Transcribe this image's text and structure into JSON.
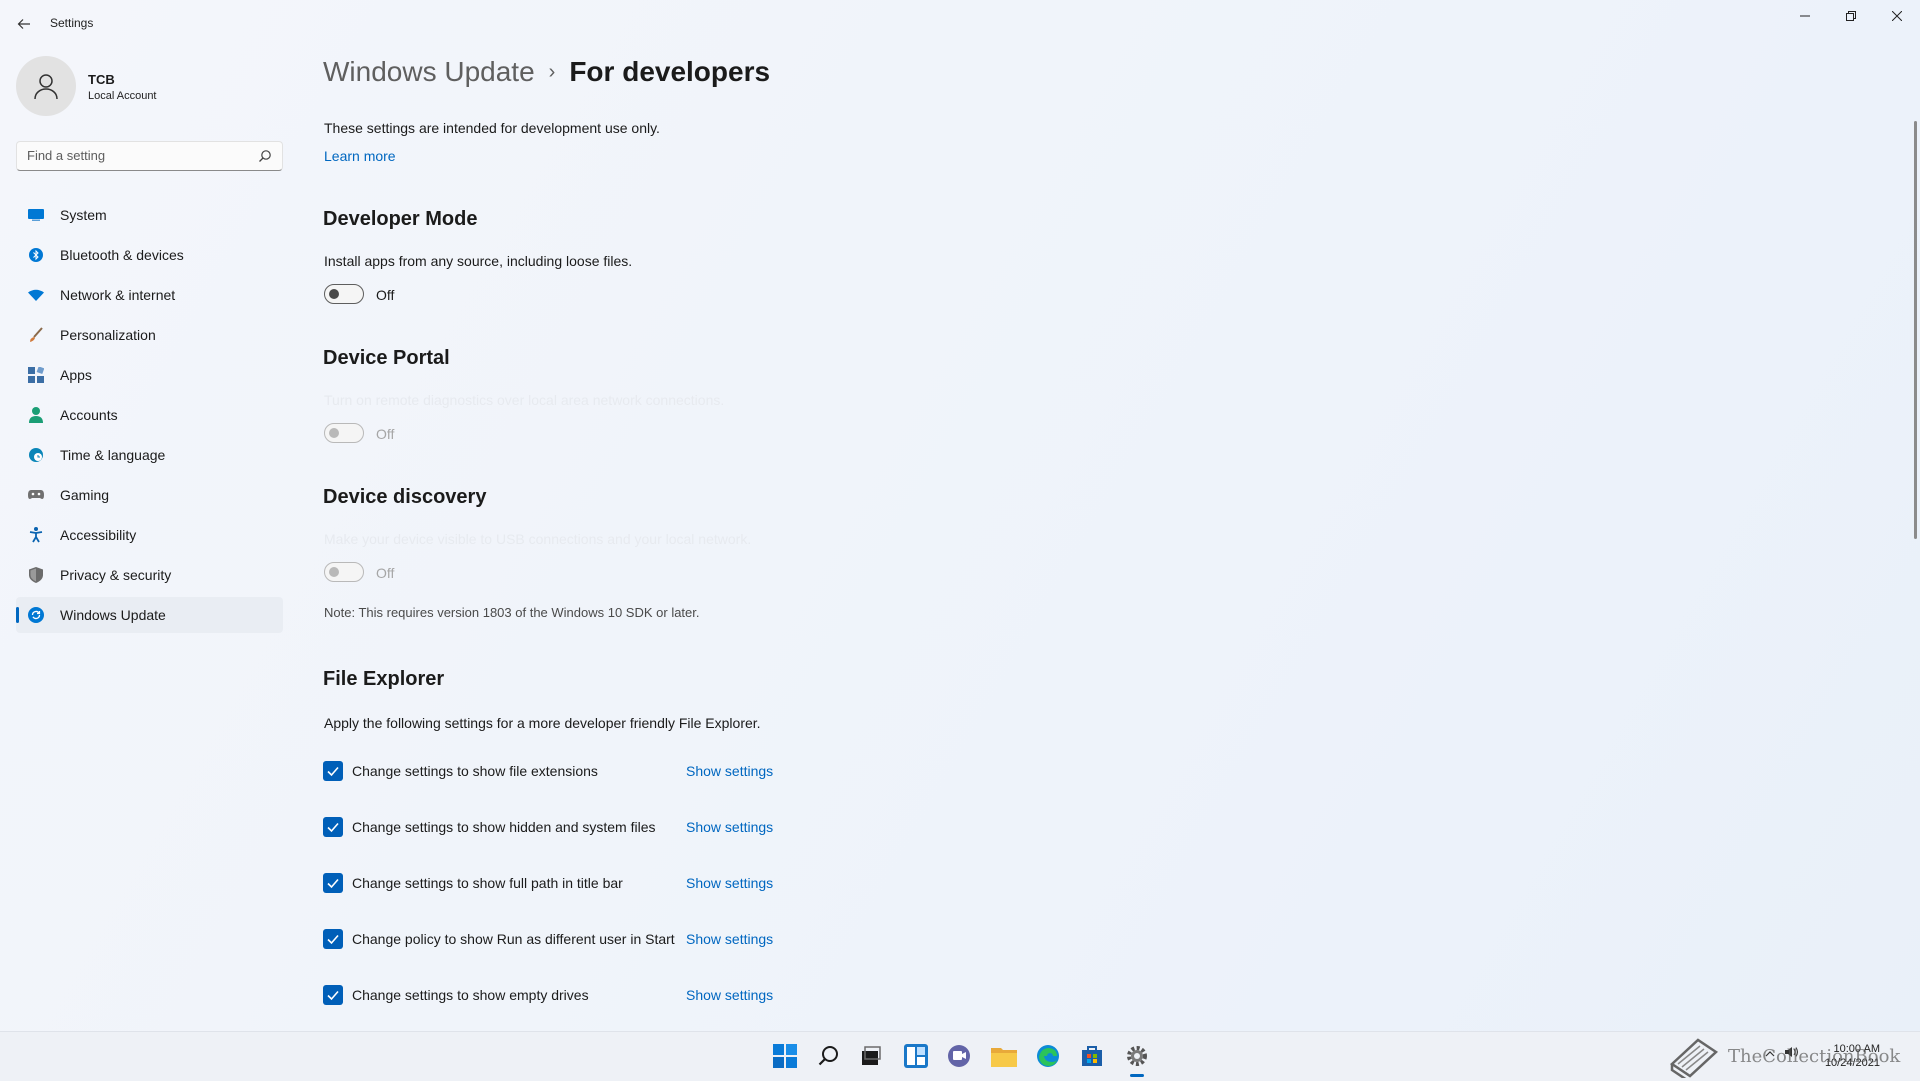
{
  "window": {
    "title": "Settings"
  },
  "profile": {
    "name": "TCB",
    "account_type": "Local Account"
  },
  "search": {
    "placeholder": "Find a setting"
  },
  "sidebar": {
    "items": [
      {
        "label": "System",
        "icon": "system-icon",
        "color": "#0078d4"
      },
      {
        "label": "Bluetooth & devices",
        "icon": "bluetooth-icon",
        "color": "#0078d4"
      },
      {
        "label": "Network & internet",
        "icon": "wifi-icon",
        "color": "#0078d4"
      },
      {
        "label": "Personalization",
        "icon": "brush-icon",
        "color": "#d07a3b"
      },
      {
        "label": "Apps",
        "icon": "apps-icon",
        "color": "#3b6ea5"
      },
      {
        "label": "Accounts",
        "icon": "person-icon",
        "color": "#1a9e75"
      },
      {
        "label": "Time & language",
        "icon": "globe-clock-icon",
        "color": "#0a86b8"
      },
      {
        "label": "Gaming",
        "icon": "gamepad-icon",
        "color": "#707070"
      },
      {
        "label": "Accessibility",
        "icon": "accessibility-icon",
        "color": "#0a63b0"
      },
      {
        "label": "Privacy & security",
        "icon": "shield-icon",
        "color": "#6b6b6b"
      },
      {
        "label": "Windows Update",
        "icon": "update-icon",
        "color": "#0078d4",
        "active": true
      }
    ]
  },
  "breadcrumb": {
    "parent": "Windows Update",
    "separator": "›",
    "current": "For developers"
  },
  "intro": {
    "text": "These settings are intended for development use only.",
    "learn_more": "Learn more"
  },
  "developer_mode": {
    "title": "Developer Mode",
    "description": "Install apps from any source, including loose files.",
    "toggle_label": "Off",
    "enabled": false
  },
  "device_portal": {
    "title": "Device Portal",
    "description": "Turn on remote diagnostics over local area network connections.",
    "toggle_label": "Off",
    "enabled": false
  },
  "device_discovery": {
    "title": "Device discovery",
    "description": "Make your device visible to USB connections and your local network.",
    "toggle_label": "Off",
    "enabled": false,
    "note": "Note: This requires version 1803 of the Windows 10 SDK or later."
  },
  "file_explorer": {
    "title": "File Explorer",
    "description": "Apply the following settings for a more developer friendly File Explorer.",
    "options": [
      {
        "label": "Change settings to show file extensions",
        "checked": true,
        "link": "Show settings"
      },
      {
        "label": "Change settings to show hidden and system files",
        "checked": true,
        "link": "Show settings"
      },
      {
        "label": "Change settings to show full path in title bar",
        "checked": true,
        "link": "Show settings"
      },
      {
        "label": "Change policy to show Run as different user in Start",
        "checked": true,
        "link": "Show settings"
      },
      {
        "label": "Change settings to show empty drives",
        "checked": true,
        "link": "Show settings"
      }
    ]
  },
  "taskbar": {
    "icons": [
      "start-icon",
      "search-icon",
      "task-view-icon",
      "widgets-icon",
      "teams-chat-icon",
      "file-explorer-icon",
      "edge-icon",
      "store-icon",
      "settings-icon"
    ],
    "watermark": "TheCollectionBook",
    "time": "10:00 AM",
    "date": "10/24/2021"
  },
  "colors": {
    "accent": "#0067c0",
    "checkbox": "#005fb8"
  }
}
